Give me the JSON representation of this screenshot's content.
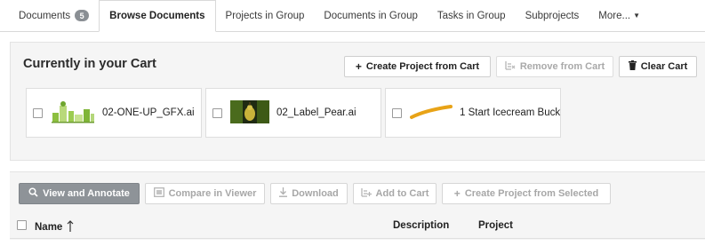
{
  "tabs": [
    {
      "label": "Documents",
      "badge": "5"
    },
    {
      "label": "Browse Documents",
      "active": true
    },
    {
      "label": "Projects in Group"
    },
    {
      "label": "Documents in Group"
    },
    {
      "label": "Tasks in Group"
    },
    {
      "label": "Subprojects"
    },
    {
      "label": "More..."
    }
  ],
  "cart": {
    "title": "Currently in your Cart",
    "create_project_label": "Create Project from Cart",
    "remove_label": "Remove from Cart",
    "clear_label": "Clear Cart",
    "items": [
      {
        "name": "02-ONE-UP_GFX.ai"
      },
      {
        "name": "02_Label_Pear.ai"
      },
      {
        "name": "1 Start Icecream Buck.."
      }
    ]
  },
  "toolbar": {
    "view_annotate": "View and Annotate",
    "compare": "Compare in Viewer",
    "download": "Download",
    "add_to_cart": "Add to Cart",
    "create_from_selected": "Create Project from Selected"
  },
  "grid": {
    "columns": {
      "name": "Name",
      "description": "Description",
      "project": "Project"
    },
    "sort_icon": "arrow-up"
  },
  "colors": {
    "primary_button": "#8e9398",
    "panel_bg": "#f5f5f5",
    "badge": "#8a8f94",
    "icecream_stroke": "#e8a317"
  }
}
